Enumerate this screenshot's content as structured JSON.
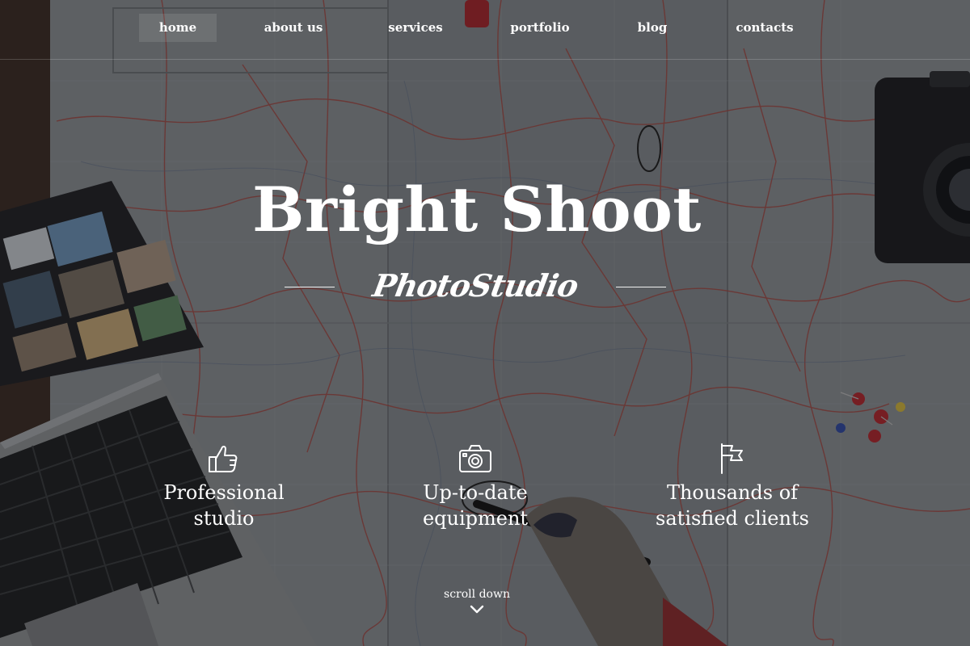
{
  "nav": {
    "items": [
      {
        "label": "home",
        "active": true
      },
      {
        "label": "about us",
        "active": false
      },
      {
        "label": "services",
        "active": false
      },
      {
        "label": "portfolio",
        "active": false
      },
      {
        "label": "blog",
        "active": false
      },
      {
        "label": "contacts",
        "active": false
      }
    ]
  },
  "hero": {
    "title": "Bright Shoot",
    "subtitle": "PhotoStudio"
  },
  "features": [
    {
      "icon": "thumbs-up-icon",
      "label": "Professional\nstudio"
    },
    {
      "icon": "camera-icon",
      "label": "Up-to-date\nequipment"
    },
    {
      "icon": "flag-icon",
      "label": "Thousands of\nsatisfied clients"
    }
  ],
  "scroll": {
    "label": "scroll down",
    "icon": "chevron-down-icon"
  },
  "colors": {
    "text": "#ffffff",
    "overlay": "#121316",
    "map_paper": "#8f9498",
    "map_roads": "#b3413a"
  }
}
